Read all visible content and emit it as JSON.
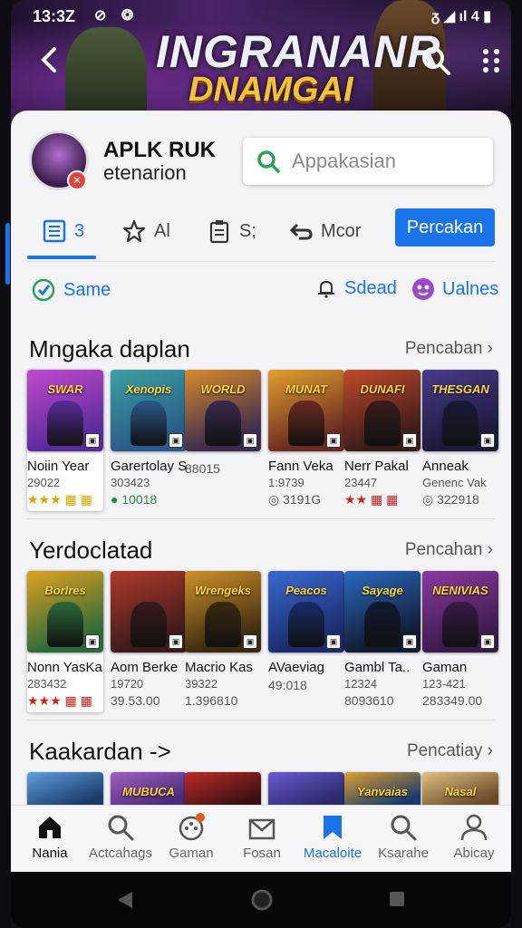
{
  "status": {
    "time": "13:3Z",
    "icons_left": "⊘ ❂",
    "icons_right": "ᵹ ◢ ıl 4 ▮"
  },
  "hero": {
    "title_line1": "INGRANANR",
    "title_line2": "DNAMGAI"
  },
  "app": {
    "name": "APLK RUK",
    "subtitle": "etenarion",
    "badge": "✕"
  },
  "search": {
    "placeholder": "Appakasian"
  },
  "tabs": [
    {
      "label": "3",
      "icon": "grid-list-icon"
    },
    {
      "label": "Al",
      "icon": "star-icon"
    },
    {
      "label": "S;",
      "icon": "clipboard-icon"
    },
    {
      "label": "Mcor",
      "icon": "exchange-icon"
    }
  ],
  "tab_button": "Percakan",
  "filters": [
    {
      "label": "Same",
      "icon": "check-circle-icon"
    },
    {
      "label": "Sdead",
      "icon": "bell-icon"
    },
    {
      "label": "Ualnes",
      "icon": "puzzle-icon"
    }
  ],
  "sections": [
    {
      "title": "Mngaka daplan",
      "link": "Pencaban",
      "cards": [
        {
          "cover_text": "SWAR",
          "title": "Noiin Year",
          "line2": "29022",
          "line3": "★★★ ▦ ▦",
          "colors": [
            "#5a2a9a",
            "#c04ad0"
          ]
        },
        {
          "cover_text": "Xenopis",
          "title": "Garertolay Se",
          "line2": "303423",
          "line3": "● 10018",
          "colors": [
            "#2a5a8a",
            "#3aa0a0"
          ]
        },
        {
          "cover_text": "WORLD",
          "title": "",
          "line2": "",
          "line3": "88015",
          "colors": [
            "#3a2a50",
            "#d88a2a"
          ]
        },
        {
          "cover_text": "MUNAT",
          "title": "Fann Veka",
          "line2": "1:9739",
          "line3": "◎ 3191G",
          "colors": [
            "#6a2a20",
            "#e0a030"
          ]
        },
        {
          "cover_text": "DUNAFI",
          "title": "Nerr Pakal",
          "line2": "23447",
          "line3": "★★ ▦ ▦",
          "colors": [
            "#3a1a1a",
            "#c04a2a"
          ]
        },
        {
          "cover_text": "THESGAN",
          "title": "Anneak",
          "line2": "Genenc Vak",
          "line3": "◎ 322918",
          "colors": [
            "#1a1a3a",
            "#4a3a8a"
          ]
        }
      ]
    },
    {
      "title": "Yerdoclatad",
      "link": "Pencahan",
      "cards": [
        {
          "cover_text": "Borlres",
          "title": "Nonn YasKar",
          "line2": "283432",
          "line3": "★★★ ▦ ▦",
          "colors": [
            "#2a6a3a",
            "#e0a020"
          ]
        },
        {
          "cover_text": "",
          "title": "Aom Berke",
          "line2": "19720",
          "line3": "39.53.00",
          "colors": [
            "#3a1a1a",
            "#b03a2a"
          ]
        },
        {
          "cover_text": "Wrengeks",
          "title": "Macrio Kas",
          "line2": "39322",
          "line3": "1.396810",
          "colors": [
            "#3a2a10",
            "#d0902a"
          ]
        },
        {
          "cover_text": "Peacos",
          "title": "AVaeviag",
          "line2": "",
          "line3": "49:018",
          "colors": [
            "#1a2a6a",
            "#3a6ad0"
          ]
        },
        {
          "cover_text": "Sayage",
          "title": "Gambl Ta..",
          "line2": "12324",
          "line3": "8093610",
          "colors": [
            "#101a30",
            "#2a6ac0"
          ]
        },
        {
          "cover_text": "NENIVIAS",
          "title": "Gaman",
          "line2": "123-421",
          "line3": "283349.00",
          "colors": [
            "#3a1a4a",
            "#8a3aa0"
          ]
        }
      ]
    },
    {
      "title": "Kaakardan ->",
      "link": "Pencatiay",
      "cards": [
        {
          "cover_text": "",
          "colors": [
            "#1a3a6a",
            "#60a0e0"
          ]
        },
        {
          "cover_text": "MUBUCA",
          "colors": [
            "#4a2a7a",
            "#a060c0"
          ]
        },
        {
          "cover_text": "",
          "colors": [
            "#3a1010",
            "#c02a2a"
          ]
        },
        {
          "cover_text": "",
          "colors": [
            "#2a2a6a",
            "#6a5ad0"
          ]
        },
        {
          "cover_text": "Yanvaias",
          "colors": [
            "#1a3a6a",
            "#e0a030"
          ]
        },
        {
          "cover_text": "Nasal",
          "colors": [
            "#6a4a2a",
            "#e0c080"
          ]
        }
      ]
    }
  ],
  "bottom_nav": [
    {
      "label": "Nania",
      "icon": "home-icon"
    },
    {
      "label": "Actcahags",
      "icon": "search-icon"
    },
    {
      "label": "Gaman",
      "icon": "gamepad-icon"
    },
    {
      "label": "Fosan",
      "icon": "mail-icon"
    },
    {
      "label": "Macaloite",
      "icon": "bookmark-icon"
    },
    {
      "label": "Ksarahe",
      "icon": "search-icon"
    },
    {
      "label": "Abicay",
      "icon": "person-icon"
    }
  ]
}
